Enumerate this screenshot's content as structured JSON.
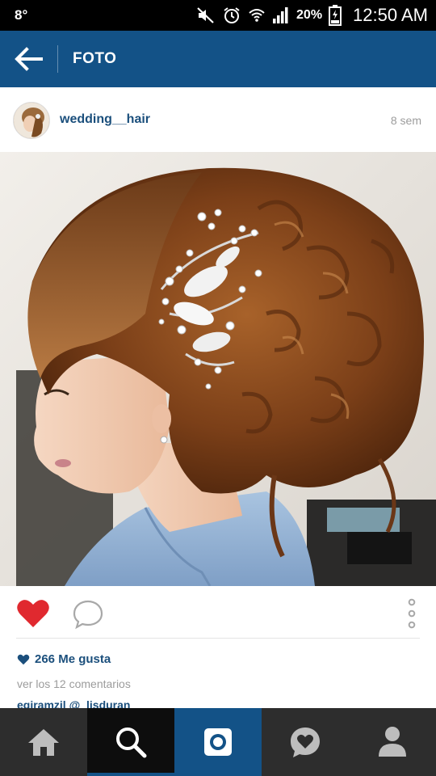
{
  "status_bar": {
    "temperature": "8°",
    "battery_percent": "20%",
    "time": "12:50 AM",
    "icons": [
      "mute-icon",
      "alarm-icon",
      "wifi-icon",
      "signal-icon",
      "battery-icon"
    ]
  },
  "app_bar": {
    "back_icon": "arrow-left-icon",
    "title": "FOTO"
  },
  "post": {
    "username": "wedding__hair",
    "time_ago": "8 sem",
    "avatar_icon": "profile-avatar"
  },
  "actions": {
    "like_icon": "heart-filled-icon",
    "comment_icon": "comment-bubble-icon",
    "more_icon": "vertical-dots-icon",
    "likes_text": "266 Me gusta",
    "view_comments": "ver los 12 comentarios",
    "comment_preview": "egiramzil @_lisduran"
  },
  "bottom_nav": {
    "items": [
      {
        "name": "home",
        "icon": "home-icon"
      },
      {
        "name": "search",
        "icon": "search-icon",
        "active": true
      },
      {
        "name": "camera",
        "icon": "camera-icon"
      },
      {
        "name": "activity",
        "icon": "heart-bubble-icon"
      },
      {
        "name": "profile",
        "icon": "person-icon"
      }
    ]
  },
  "colors": {
    "brand_blue": "#135287",
    "link_blue": "#1b4f7c",
    "like_red": "#e0292f",
    "muted_gray": "#9c9c9c"
  }
}
